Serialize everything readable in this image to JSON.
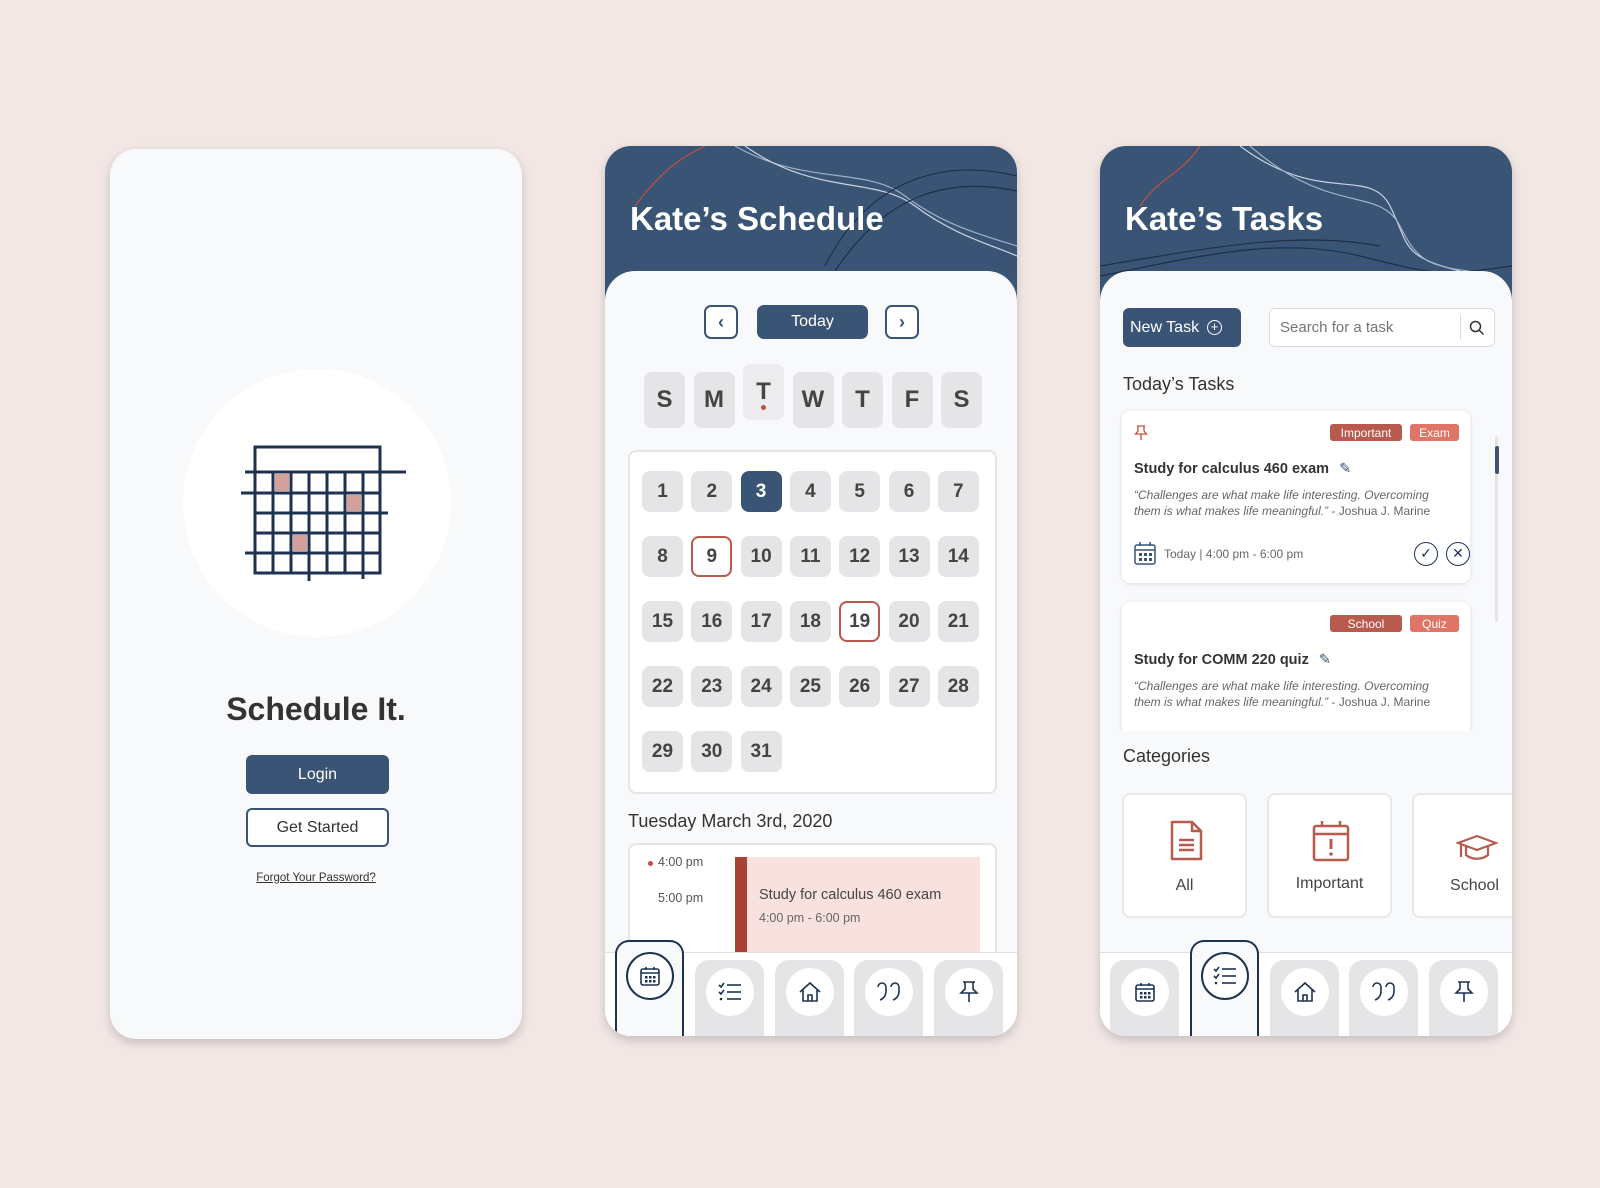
{
  "login": {
    "app_title": "Schedule It.",
    "login_label": "Login",
    "get_started_label": "Get Started",
    "forgot_label": "Forgot Your Password?"
  },
  "schedule": {
    "title": "Kate’s Schedule",
    "today_label": "Today",
    "weekdays": [
      "S",
      "M",
      "T",
      "W",
      "T",
      "F",
      "S"
    ],
    "current_weekday_index": 2,
    "days": [
      "1",
      "2",
      "3",
      "4",
      "5",
      "6",
      "7",
      "8",
      "9",
      "10",
      "11",
      "12",
      "13",
      "14",
      "15",
      "16",
      "17",
      "18",
      "19",
      "20",
      "21",
      "22",
      "23",
      "24",
      "25",
      "26",
      "27",
      "28",
      "29",
      "30",
      "31"
    ],
    "selected_day": "3",
    "marked_days": [
      "9",
      "19"
    ],
    "date_heading": "Tuesday March 3rd, 2020",
    "times": [
      "4:00 pm",
      "5:00 pm"
    ],
    "event": {
      "title": "Study for calculus 460 exam",
      "time": "4:00 pm - 6:00 pm"
    }
  },
  "tasks": {
    "title": "Kate’s Tasks",
    "new_task_label": "New Task",
    "search_placeholder": "Search for a task",
    "todays_heading": "Today’s Tasks",
    "items": [
      {
        "tags": [
          "Important",
          "Exam"
        ],
        "title": "Study for calculus 460 exam",
        "quote": "“Challenges are what make life interesting. Overcoming them is what makes life meaningful.”",
        "author": " - Joshua J. Marine",
        "when": "Today | 4:00 pm - 6:00 pm",
        "pinned": true
      },
      {
        "tags": [
          "School",
          "Quiz"
        ],
        "title": "Study for COMM 220 quiz",
        "quote": "“Challenges are what make life interesting. Overcoming them is what makes life meaningful.”",
        "author": " - Joshua J. Marine"
      }
    ],
    "categories_heading": "Categories",
    "categories": [
      "All",
      "Important",
      "School"
    ]
  },
  "nav_icons": [
    "calendar-icon",
    "checklist-icon",
    "home-icon",
    "quote-icon",
    "pin-icon"
  ],
  "colors": {
    "primary": "#3a5475",
    "accent": "#b85a4e",
    "tag_light": "#e07466",
    "event_bg": "#f8e1df",
    "background": "#f2e7e5"
  }
}
